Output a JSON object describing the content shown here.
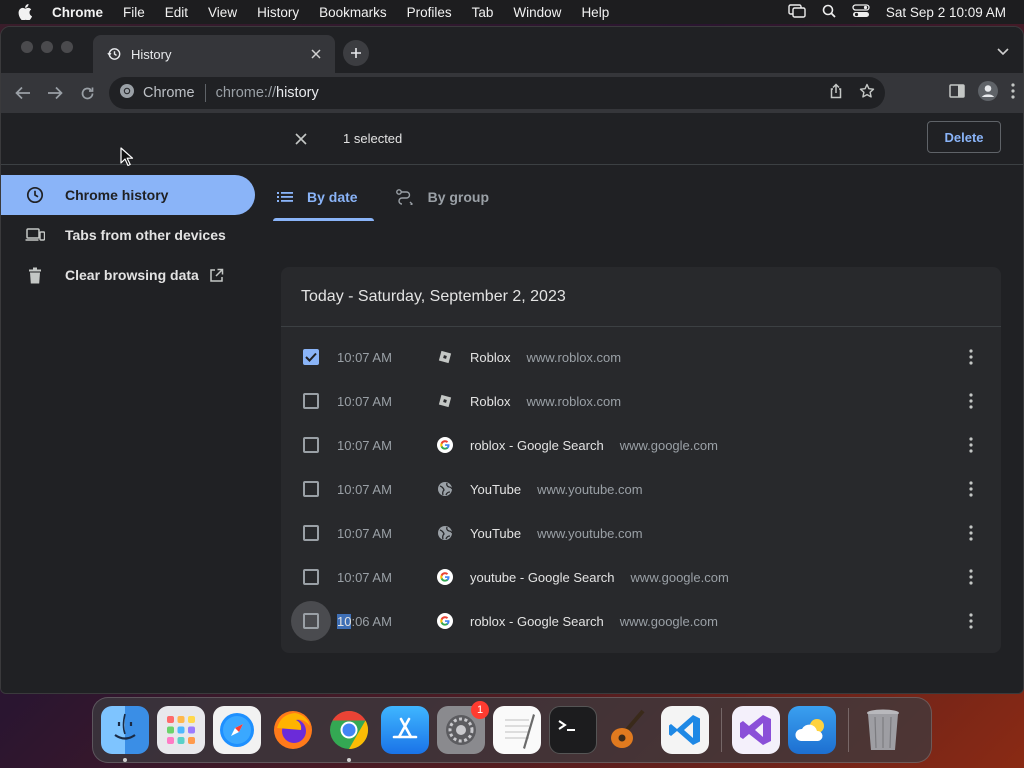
{
  "menubar": {
    "items": [
      "Chrome",
      "File",
      "Edit",
      "View",
      "History",
      "Bookmarks",
      "Profiles",
      "Tab",
      "Window",
      "Help"
    ],
    "clock": "Sat Sep 2  10:09 AM"
  },
  "browser": {
    "tab_title": "History",
    "omnibox": {
      "site_label": "Chrome",
      "url_scheme": "chrome://",
      "url_path": "history"
    }
  },
  "history_page": {
    "selection_count": "1 selected",
    "delete_label": "Delete",
    "sidebar": [
      {
        "label": "Chrome history",
        "icon": "clock-icon",
        "active": true
      },
      {
        "label": "Tabs from other devices",
        "icon": "devices-icon",
        "active": false
      },
      {
        "label": "Clear browsing data",
        "icon": "trash-icon",
        "active": false
      }
    ],
    "view_tabs": [
      {
        "label": "By date",
        "active": true
      },
      {
        "label": "By group",
        "active": false
      }
    ],
    "day_header": "Today - Saturday, September 2, 2023",
    "entries": [
      {
        "time_prefix": "",
        "time": "10:07 AM",
        "title": "Roblox",
        "domain": "www.roblox.com",
        "favicon": "roblox-icon",
        "checked": true
      },
      {
        "time_prefix": "",
        "time": "10:07 AM",
        "title": "Roblox",
        "domain": "www.roblox.com",
        "favicon": "roblox-icon",
        "checked": false
      },
      {
        "time_prefix": "",
        "time": "10:07 AM",
        "title": "roblox - Google Search",
        "domain": "www.google.com",
        "favicon": "google-icon",
        "checked": false
      },
      {
        "time_prefix": "",
        "time": "10:07 AM",
        "title": "YouTube",
        "domain": "www.youtube.com",
        "favicon": "globe-icon",
        "checked": false
      },
      {
        "time_prefix": "",
        "time": "10:07 AM",
        "title": "YouTube",
        "domain": "www.youtube.com",
        "favicon": "globe-icon",
        "checked": false
      },
      {
        "time_prefix": "",
        "time": "10:07 AM",
        "title": "youtube - Google Search",
        "domain": "www.google.com",
        "favicon": "google-icon",
        "checked": false
      },
      {
        "time_prefix": "10",
        "time": ":06 AM",
        "title": "roblox - Google Search",
        "domain": "www.google.com",
        "favicon": "google-icon",
        "checked": false
      }
    ]
  },
  "dock": {
    "apps": [
      "Finder",
      "Launchpad",
      "Safari",
      "Firefox",
      "Chrome",
      "App Store",
      "System Settings",
      "TextEdit",
      "Terminal",
      "GarageBand",
      "Visual Studio Code",
      "Visual Studio",
      "Weather",
      "Trash"
    ],
    "settings_badge": "1"
  },
  "colors": {
    "accent": "#8ab4f8",
    "page_bg": "#202124",
    "card_bg": "#28292c"
  }
}
